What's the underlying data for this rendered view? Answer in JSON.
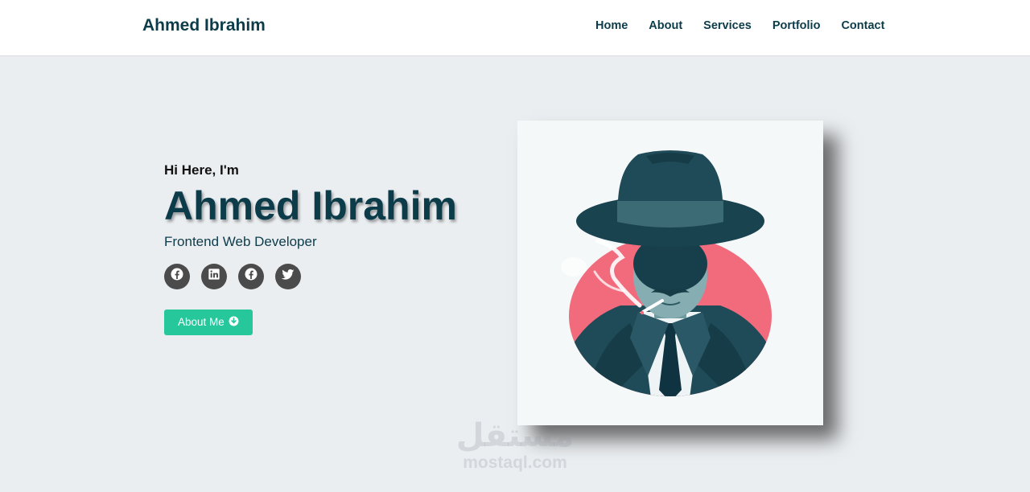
{
  "nav": {
    "brand": "Ahmed Ibrahim",
    "links": [
      "Home",
      "About",
      "Services",
      "Portfolio",
      "Contact"
    ]
  },
  "hero": {
    "greeting": "Hi Here, I'm",
    "name": "Ahmed Ibrahim",
    "role": "Frontend Web Developer",
    "socials": [
      "facebook-icon",
      "linkedin-icon",
      "facebook-icon",
      "twitter-icon"
    ],
    "button_label": "About Me",
    "button_icon": "arrow-down-circle-icon"
  },
  "portrait": {
    "subject": "avatar-detective-illustration"
  },
  "watermark": {
    "arabic": "مستقل",
    "latin": "mostaql.com"
  },
  "colors": {
    "primary": "#0c3c4a",
    "accent": "#25c79b",
    "background": "#ebeef1",
    "social_bg": "#4b4b4b"
  }
}
